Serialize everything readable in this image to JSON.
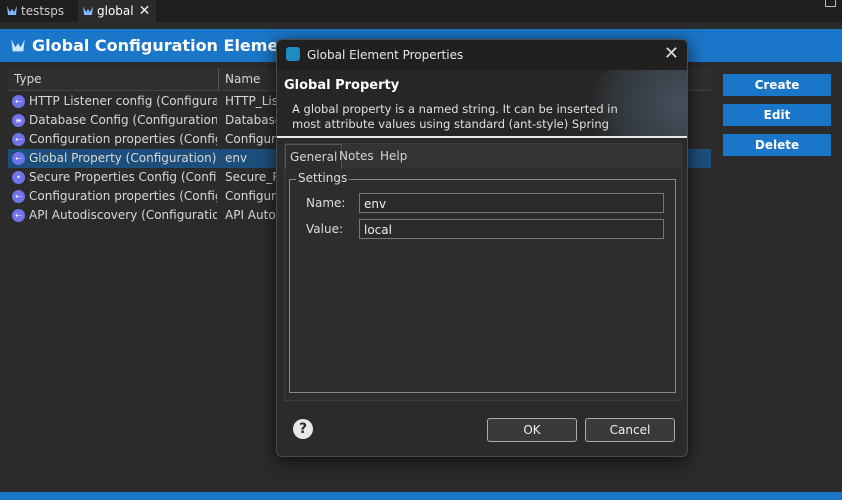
{
  "editor_tabs": [
    {
      "label": "testsps",
      "icon": "mule-icon"
    },
    {
      "label": "global",
      "icon": "mule-icon",
      "close": "✕"
    }
  ],
  "header": {
    "title": "Global Configuration Elements",
    "icon": "mule-icon",
    "color": "#1a76c8"
  },
  "table": {
    "columns": [
      "Type",
      "Name"
    ],
    "rows": [
      {
        "type": "HTTP Listener config (Configuration)",
        "name": "HTTP_Listener_config"
      },
      {
        "type": "Database Config (Configuration)",
        "name": "Database_Config"
      },
      {
        "type": "Configuration properties (Configuration)",
        "name": "Configuration properties"
      },
      {
        "type": "Global Property (Configuration)",
        "name": "env"
      },
      {
        "type": "Secure Properties Config (Configuration)",
        "name": "Secure_Properties_Config"
      },
      {
        "type": "Configuration properties (Configuration)",
        "name": "Configuration properties"
      },
      {
        "type": "API Autodiscovery (Configuration)",
        "name": "API Autodiscovery"
      }
    ],
    "selected_index": 3
  },
  "actions": {
    "create": "Create",
    "edit": "Edit",
    "delete": "Delete"
  },
  "dialog": {
    "title": "Global Element Properties",
    "close": "✕",
    "heading": "Global Property",
    "description": "A global property is a named string. It can be inserted in most attribute values using standard (ant-style) Spring",
    "tabs": [
      "General",
      "Notes",
      "Help"
    ],
    "active_tab": "General",
    "group_label": "Settings",
    "name_label": "Name:",
    "name_value": "env",
    "value_label": "Value:",
    "value_value": "local",
    "ok": "OK",
    "cancel": "Cancel",
    "help": "?"
  }
}
